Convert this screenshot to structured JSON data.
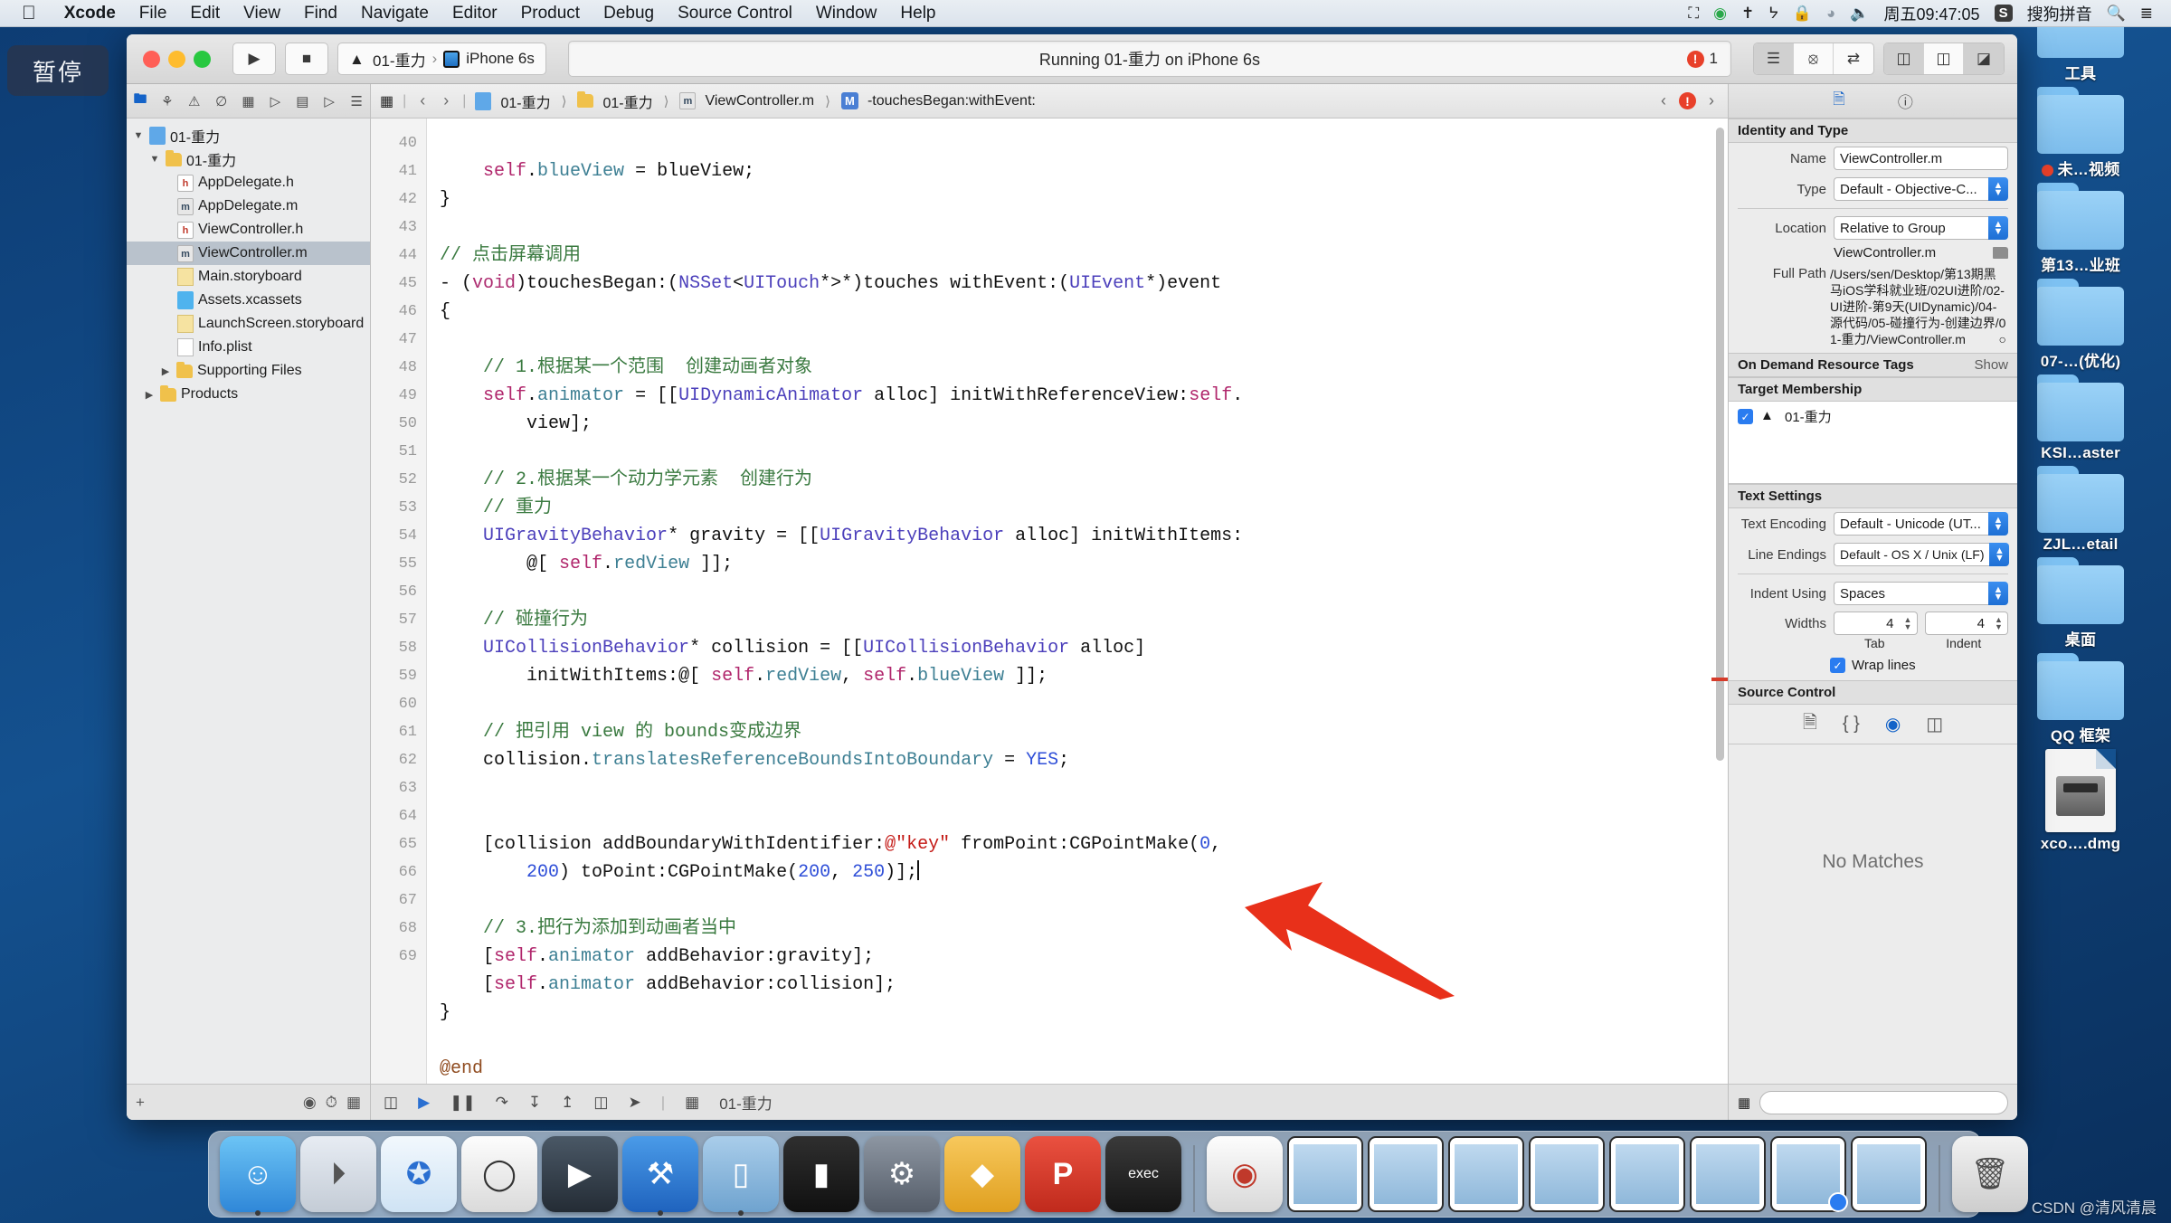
{
  "menubar": {
    "apple_icon": "apple-icon",
    "items": [
      "Xcode",
      "File",
      "Edit",
      "View",
      "Find",
      "Navigate",
      "Editor",
      "Product",
      "Debug",
      "Source Control",
      "Window",
      "Help"
    ],
    "right_icons": [
      "screen-record-icon",
      "play-circle-icon",
      "airplay-icon",
      "bluetooth-icon",
      "lock-icon",
      "wifi-icon",
      "volume-icon"
    ],
    "clock": "周五09:47:05",
    "input_method": "搜狗拼音",
    "input_badge": "S",
    "search_icon": "search-icon",
    "control_center_icon": "list-icon"
  },
  "pause_overlay": {
    "label": "暂停"
  },
  "toolbar": {
    "run_icon": "play-icon",
    "stop_icon": "stop-icon",
    "scheme_name": "01-重力",
    "scheme_separator": "›",
    "destination": "iPhone 6s",
    "status_text": "Running 01-重力 on iPhone 6s",
    "error_count": "1",
    "editor_segments": [
      "standard-editor-icon",
      "assistant-editor-icon",
      "version-editor-icon"
    ],
    "view_segments": [
      "navigator-toggle-icon",
      "debug-area-toggle-icon",
      "utilities-toggle-icon"
    ]
  },
  "navigator": {
    "tabs": [
      "project-navigator-icon",
      "source-control-icon",
      "symbol-navigator-icon",
      "find-navigator-icon",
      "issue-navigator-icon",
      "test-navigator-icon",
      "debug-navigator-icon",
      "breakpoint-navigator-icon",
      "report-navigator-icon"
    ],
    "tree": [
      {
        "label": "01-重力",
        "depth": 0,
        "icon": "project-icon",
        "disc": "▼",
        "selected": false
      },
      {
        "label": "01-重力",
        "depth": 1,
        "icon": "folder-icon",
        "disc": "▼",
        "selected": false
      },
      {
        "label": "AppDelegate.h",
        "depth": 2,
        "icon": "header-file-icon",
        "disc": "",
        "selected": false
      },
      {
        "label": "AppDelegate.m",
        "depth": 2,
        "icon": "implementation-file-icon",
        "disc": "",
        "selected": false
      },
      {
        "label": "ViewController.h",
        "depth": 2,
        "icon": "header-file-icon",
        "disc": "",
        "selected": false
      },
      {
        "label": "ViewController.m",
        "depth": 2,
        "icon": "implementation-file-icon",
        "disc": "",
        "selected": true
      },
      {
        "label": "Main.storyboard",
        "depth": 2,
        "icon": "storyboard-icon",
        "disc": "",
        "selected": false
      },
      {
        "label": "Assets.xcassets",
        "depth": 2,
        "icon": "asset-catalog-icon",
        "disc": "",
        "selected": false
      },
      {
        "label": "LaunchScreen.storyboard",
        "depth": 2,
        "icon": "storyboard-icon",
        "disc": "",
        "selected": false
      },
      {
        "label": "Info.plist",
        "depth": 2,
        "icon": "plist-icon",
        "disc": "",
        "selected": false
      },
      {
        "label": "Supporting Files",
        "depth": 1,
        "icon": "folder-icon",
        "disc": "▶",
        "selected": false
      },
      {
        "label": "Products",
        "depth": 0,
        "icon": "folder-icon",
        "disc": "▶",
        "selected": false
      }
    ],
    "filter_add": "+",
    "filter_icon": "filter-icon"
  },
  "jumpbar": {
    "grid_icon": "related-items-icon",
    "back_icon": "‹",
    "forward_icon": "›",
    "crumbs": [
      {
        "label": "01-重力",
        "icon": "project-icon"
      },
      {
        "label": "01-重力",
        "icon": "folder-icon"
      },
      {
        "label": "ViewController.m",
        "icon": "implementation-file-icon"
      },
      {
        "label": "-touchesBegan:withEvent:",
        "icon": "method-icon"
      }
    ],
    "issue_prev": "‹",
    "issue_count_icon": "error-icon",
    "issue_next": "›"
  },
  "code": {
    "first_line_number": 40,
    "lines": [
      {
        "n": 40,
        "tokens": []
      },
      {
        "n": 41,
        "tokens": [
          {
            "t": "    ",
            "c": ""
          },
          {
            "t": "self",
            "c": "c-key"
          },
          {
            "t": ".",
            "c": ""
          },
          {
            "t": "blueView",
            "c": "c-prop"
          },
          {
            "t": " = blueView;",
            "c": ""
          }
        ]
      },
      {
        "n": 42,
        "tokens": [
          {
            "t": "}",
            "c": ""
          }
        ]
      },
      {
        "n": 43,
        "tokens": []
      },
      {
        "n": 44,
        "tokens": [
          {
            "t": "// 点击屏幕调用",
            "c": "c-cmt"
          }
        ]
      },
      {
        "n": 45,
        "tokens": [
          {
            "t": "- (",
            "c": ""
          },
          {
            "t": "void",
            "c": "c-kw"
          },
          {
            "t": ")touchesBegan:(",
            "c": ""
          },
          {
            "t": "NSSet",
            "c": "c-type"
          },
          {
            "t": "<",
            "c": ""
          },
          {
            "t": "UITouch",
            "c": "c-type"
          },
          {
            "t": "*>*)touches withEvent:(",
            "c": ""
          },
          {
            "t": "UIEvent",
            "c": "c-type"
          },
          {
            "t": "*)event",
            "c": ""
          }
        ]
      },
      {
        "n": 46,
        "tokens": [
          {
            "t": "{",
            "c": ""
          }
        ]
      },
      {
        "n": 47,
        "tokens": []
      },
      {
        "n": 48,
        "tokens": [
          {
            "t": "    // 1.根据某一个范围  创建动画者对象",
            "c": "c-cmt"
          }
        ]
      },
      {
        "n": 49,
        "tokens": [
          {
            "t": "    ",
            "c": ""
          },
          {
            "t": "self",
            "c": "c-key"
          },
          {
            "t": ".",
            "c": ""
          },
          {
            "t": "animator",
            "c": "c-prop"
          },
          {
            "t": " = [[",
            "c": ""
          },
          {
            "t": "UIDynamicAnimator",
            "c": "c-type"
          },
          {
            "t": " alloc] initWithReferenceView:",
            "c": ""
          },
          {
            "t": "self",
            "c": "c-key"
          },
          {
            "t": ".",
            "c": ""
          }
        ]
      },
      {
        "n": "",
        "tokens": [
          {
            "t": "        view];",
            "c": ""
          }
        ]
      },
      {
        "n": 50,
        "tokens": []
      },
      {
        "n": 51,
        "tokens": [
          {
            "t": "    // 2.根据某一个动力学元素  创建行为",
            "c": "c-cmt"
          }
        ]
      },
      {
        "n": 52,
        "tokens": [
          {
            "t": "    // 重力",
            "c": "c-cmt"
          }
        ]
      },
      {
        "n": 53,
        "tokens": [
          {
            "t": "    ",
            "c": ""
          },
          {
            "t": "UIGravityBehavior",
            "c": "c-type"
          },
          {
            "t": "* gravity = [[",
            "c": ""
          },
          {
            "t": "UIGravityBehavior",
            "c": "c-type"
          },
          {
            "t": " alloc] initWithItems:",
            "c": ""
          }
        ]
      },
      {
        "n": "",
        "tokens": [
          {
            "t": "        @[ ",
            "c": ""
          },
          {
            "t": "self",
            "c": "c-key"
          },
          {
            "t": ".",
            "c": ""
          },
          {
            "t": "redView",
            "c": "c-prop"
          },
          {
            "t": " ]];",
            "c": ""
          }
        ]
      },
      {
        "n": 54,
        "tokens": []
      },
      {
        "n": 55,
        "tokens": [
          {
            "t": "    // 碰撞行为",
            "c": "c-cmt"
          }
        ]
      },
      {
        "n": 56,
        "tokens": [
          {
            "t": "    ",
            "c": ""
          },
          {
            "t": "UICollisionBehavior",
            "c": "c-type"
          },
          {
            "t": "* collision = [[",
            "c": ""
          },
          {
            "t": "UICollisionBehavior",
            "c": "c-type"
          },
          {
            "t": " alloc]",
            "c": ""
          }
        ]
      },
      {
        "n": "",
        "tokens": [
          {
            "t": "        initWithItems:@[ ",
            "c": ""
          },
          {
            "t": "self",
            "c": "c-key"
          },
          {
            "t": ".",
            "c": ""
          },
          {
            "t": "redView",
            "c": "c-prop"
          },
          {
            "t": ", ",
            "c": ""
          },
          {
            "t": "self",
            "c": "c-key"
          },
          {
            "t": ".",
            "c": ""
          },
          {
            "t": "blueView",
            "c": "c-prop"
          },
          {
            "t": " ]];",
            "c": ""
          }
        ]
      },
      {
        "n": 57,
        "tokens": []
      },
      {
        "n": 58,
        "tokens": [
          {
            "t": "    // 把引用 view 的 bounds变成边界",
            "c": "c-cmt"
          }
        ]
      },
      {
        "n": 59,
        "tokens": [
          {
            "t": "    collision.",
            "c": ""
          },
          {
            "t": "translatesReferenceBoundsIntoBoundary",
            "c": "c-prop"
          },
          {
            "t": " = ",
            "c": ""
          },
          {
            "t": "YES",
            "c": "c-num"
          },
          {
            "t": ";",
            "c": ""
          }
        ]
      },
      {
        "n": 60,
        "tokens": []
      },
      {
        "n": 61,
        "tokens": []
      },
      {
        "n": 62,
        "tokens": [
          {
            "t": "    [collision addBoundaryWithIdentifier:",
            "c": ""
          },
          {
            "t": "@\"key\"",
            "c": "c-str"
          },
          {
            "t": " fromPoint:CGPointMake(",
            "c": ""
          },
          {
            "t": "0",
            "c": "c-num"
          },
          {
            "t": ",",
            "c": ""
          }
        ]
      },
      {
        "n": "",
        "tokens": [
          {
            "t": "        ",
            "c": ""
          },
          {
            "t": "200",
            "c": "c-num"
          },
          {
            "t": ") toPoint:CGPointMake(",
            "c": ""
          },
          {
            "t": "200",
            "c": "c-num"
          },
          {
            "t": ", ",
            "c": ""
          },
          {
            "t": "250",
            "c": "c-num"
          },
          {
            "t": ")];",
            "c": ""
          }
        ],
        "caret": true
      },
      {
        "n": 63,
        "tokens": []
      },
      {
        "n": 64,
        "tokens": [
          {
            "t": "    // 3.把行为添加到动画者当中",
            "c": "c-cmt"
          }
        ]
      },
      {
        "n": 65,
        "tokens": [
          {
            "t": "    [",
            "c": ""
          },
          {
            "t": "self",
            "c": "c-key"
          },
          {
            "t": ".",
            "c": ""
          },
          {
            "t": "animator",
            "c": "c-prop"
          },
          {
            "t": " addBehavior:gravity];",
            "c": ""
          }
        ]
      },
      {
        "n": 66,
        "tokens": [
          {
            "t": "    [",
            "c": ""
          },
          {
            "t": "self",
            "c": "c-key"
          },
          {
            "t": ".",
            "c": ""
          },
          {
            "t": "animator",
            "c": "c-prop"
          },
          {
            "t": " addBehavior:collision];",
            "c": ""
          }
        ]
      },
      {
        "n": 67,
        "tokens": [
          {
            "t": "}",
            "c": ""
          }
        ]
      },
      {
        "n": 68,
        "tokens": []
      },
      {
        "n": 69,
        "tokens": [
          {
            "t": "@end",
            "c": "c-pre"
          }
        ]
      }
    ],
    "bottom_bar_icons": [
      "show-hide-icon",
      "breakpoint-icon",
      "pause-icon",
      "step-over-icon",
      "step-into-icon",
      "step-out-icon",
      "view-debug-icon",
      "location-icon"
    ],
    "bottom_bar_scheme": "01-重力"
  },
  "inspector": {
    "tabs": [
      "file-inspector-icon",
      "quick-help-icon"
    ],
    "identity_and_type": {
      "header": "Identity and Type",
      "name_label": "Name",
      "name_value": "ViewController.m",
      "type_label": "Type",
      "type_value": "Default - Objective-C...",
      "location_label": "Location",
      "location_value": "Relative to Group",
      "location_file": "ViewController.m",
      "full_path_label": "Full Path",
      "full_path_value": "/Users/sen/Desktop/第13期黑马iOS学科就业班/02UI进阶/02-UI进阶-第9天(UIDynamic)/04-源代码/05-碰撞行为-创建边界/01-重力/ViewController.m"
    },
    "on_demand": {
      "header": "On Demand Resource Tags",
      "show": "Show"
    },
    "target_membership": {
      "header": "Target Membership",
      "target": "01-重力",
      "checked": true
    },
    "text_settings": {
      "header": "Text Settings",
      "encoding_label": "Text Encoding",
      "encoding_value": "Default - Unicode (UT...",
      "line_endings_label": "Line Endings",
      "line_endings_value": "Default - OS X / Unix (LF)",
      "indent_label": "Indent Using",
      "indent_value": "Spaces",
      "widths_label": "Widths",
      "tab_width": "4",
      "indent_width": "4",
      "tab_caption": "Tab",
      "indent_caption": "Indent",
      "wrap_lines_label": "Wrap lines",
      "wrap_lines_checked": true
    },
    "source_control": {
      "header": "Source Control"
    },
    "quick_help_icons": [
      "file-icon",
      "braces-icon",
      "target-icon",
      "layout-icon"
    ],
    "no_matches": "No Matches",
    "filter_icon": "filter-icon"
  },
  "desktop": {
    "items": [
      {
        "label": "工具",
        "type": "folder",
        "partial": true
      },
      {
        "label": "未…视频",
        "type": "folder",
        "dot": true
      },
      {
        "label": "第13…业班",
        "type": "folder"
      },
      {
        "label": "07-…(优化)",
        "type": "folder"
      },
      {
        "label": "KSI…aster",
        "type": "folder"
      },
      {
        "label": "ZJL…etail",
        "type": "folder"
      },
      {
        "label": "桌面",
        "type": "folder"
      },
      {
        "label": "QQ 框架",
        "type": "folder"
      },
      {
        "label": "xco….dmg",
        "type": "dmg"
      }
    ]
  },
  "dock": {
    "apps": [
      {
        "name": "finder",
        "glyph": "☺",
        "color": "#3aa0e8",
        "running": true
      },
      {
        "name": "launchpad",
        "glyph": "🚀",
        "color": "#d7dde6",
        "running": false
      },
      {
        "name": "safari",
        "glyph": "🧭",
        "color": "#e9f3fb",
        "running": false
      },
      {
        "name": "mouse-utility",
        "glyph": "🖱",
        "color": "#f2f2f2",
        "running": false
      },
      {
        "name": "quicktime",
        "glyph": "🎬",
        "color": "#3d4a57",
        "running": false
      },
      {
        "name": "xcode",
        "glyph": "🔨",
        "color": "#2e7ad1",
        "running": true
      },
      {
        "name": "simulator",
        "glyph": "📱",
        "color": "#7fb3e0",
        "running": true
      },
      {
        "name": "terminal",
        "glyph": "▮",
        "color": "#1e1e1e",
        "running": false
      },
      {
        "name": "system-preferences",
        "glyph": "⚙",
        "color": "#6b7480",
        "running": false
      },
      {
        "name": "sketch",
        "glyph": "◆",
        "color": "#f0b542",
        "running": false
      },
      {
        "name": "prototype-app",
        "glyph": "P",
        "color": "#d93c2b",
        "running": false
      },
      {
        "name": "executable",
        "glyph": "exec",
        "color": "#2b2b2b",
        "running": false
      }
    ],
    "browser": {
      "name": "browser",
      "glyph": "◉",
      "color": "#e8e8e8"
    },
    "simulator_windows": 9,
    "trash": {
      "name": "trash",
      "glyph": "🗑"
    }
  },
  "watermark": "CSDN @清风清晨"
}
